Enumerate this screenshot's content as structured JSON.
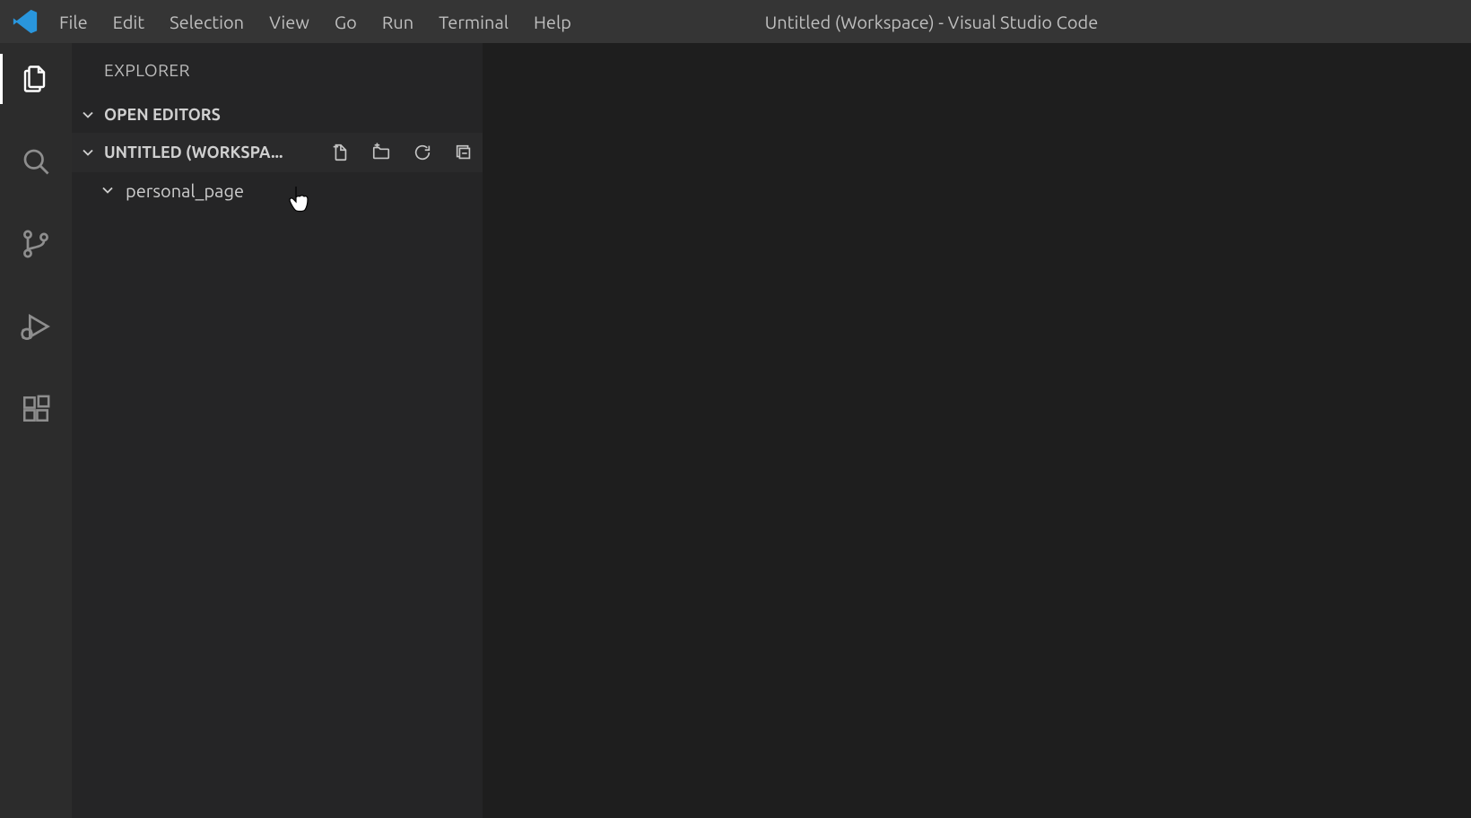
{
  "menubar": {
    "items": [
      "File",
      "Edit",
      "Selection",
      "View",
      "Go",
      "Run",
      "Terminal",
      "Help"
    ]
  },
  "window": {
    "title": "Untitled (Workspace) - Visual Studio Code"
  },
  "activitybar": {
    "items": [
      {
        "name": "explorer",
        "active": true
      },
      {
        "name": "search",
        "active": false
      },
      {
        "name": "scm",
        "active": false
      },
      {
        "name": "run-debug",
        "active": false
      },
      {
        "name": "extensions",
        "active": false
      }
    ]
  },
  "sidebar": {
    "title": "EXPLORER",
    "sections": {
      "open_editors": {
        "label": "OPEN EDITORS"
      },
      "workspace": {
        "label": "UNTITLED (WORKSPACE)",
        "actions": [
          "new-file",
          "new-folder",
          "refresh",
          "collapse-all"
        ],
        "tree": [
          {
            "type": "folder",
            "name": "personal_page",
            "expanded": true
          }
        ]
      }
    }
  }
}
